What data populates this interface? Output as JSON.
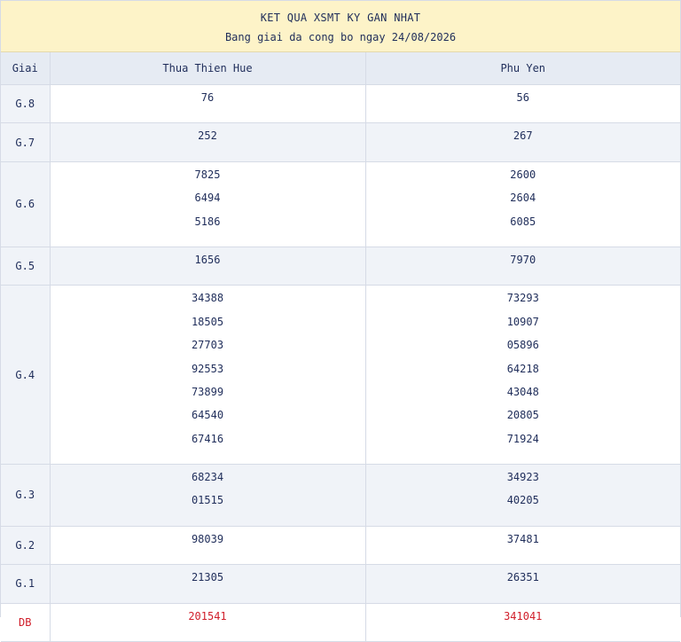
{
  "header": {
    "title": "KET QUA XSMT KY GAN NHAT",
    "subtitle": "Bang giai da cong bo ngay 24/08/2026"
  },
  "columns": [
    "Giai",
    "Thua Thien Hue",
    "Phu Yen"
  ],
  "rows": [
    {
      "prize": "G.8",
      "p1": [
        "76"
      ],
      "p2": [
        "56"
      ]
    },
    {
      "prize": "G.7",
      "p1": [
        "252"
      ],
      "p2": [
        "267"
      ]
    },
    {
      "prize": "G.6",
      "p1": [
        "7825",
        "6494",
        "5186"
      ],
      "p2": [
        "2600",
        "2604",
        "6085"
      ]
    },
    {
      "prize": "G.5",
      "p1": [
        "1656"
      ],
      "p2": [
        "7970"
      ]
    },
    {
      "prize": "G.4",
      "p1": [
        "34388",
        "18505",
        "27703",
        "92553",
        "73899",
        "64540",
        "67416"
      ],
      "p2": [
        "73293",
        "10907",
        "05896",
        "64218",
        "43048",
        "20805",
        "71924"
      ]
    },
    {
      "prize": "G.3",
      "p1": [
        "68234",
        "01515"
      ],
      "p2": [
        "34923",
        "40205"
      ]
    },
    {
      "prize": "G.2",
      "p1": [
        "98039"
      ],
      "p2": [
        "37481"
      ]
    },
    {
      "prize": "G.1",
      "p1": [
        "21305"
      ],
      "p2": [
        "26351"
      ]
    },
    {
      "prize": "DB",
      "p1": [
        "201541"
      ],
      "p2": [
        "341041"
      ]
    }
  ],
  "colors": {
    "header_bg": "#fdf3c8",
    "text": "#1f2d5a",
    "special": "#d01e2a",
    "row_shade": "#f0f3f8"
  }
}
